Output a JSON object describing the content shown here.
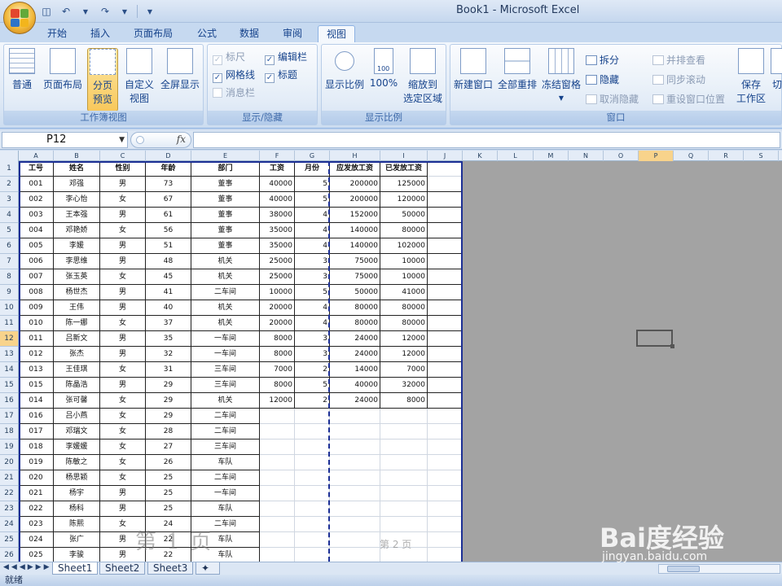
{
  "window": {
    "title": "Book1 - Microsoft Excel"
  },
  "tabs": [
    "开始",
    "插入",
    "页面布局",
    "公式",
    "数据",
    "审阅",
    "视图"
  ],
  "active_tab": "视图",
  "ribbon": {
    "workbook_views": {
      "label": "工作簿视图",
      "normal": "普通",
      "page_layout": "页面布局",
      "page_break_preview_1": "分页",
      "page_break_preview_2": "预览",
      "custom_view_1": "自定义",
      "custom_view_2": "视图",
      "full_screen": "全屏显示"
    },
    "show_hide": {
      "label": "显示/隐藏",
      "ruler": "标尺",
      "gridlines": "网格线",
      "message_bar": "消息栏",
      "formula_bar": "编辑栏",
      "headings": "标题"
    },
    "zoom": {
      "label": "显示比例",
      "zoom": "显示比例",
      "hundred": "100%",
      "zoom_sel_1": "缩放到",
      "zoom_sel_2": "选定区域",
      "icon_100": "100"
    },
    "window": {
      "label": "窗口",
      "new_window": "新建窗口",
      "arrange_all": "全部重排",
      "freeze_panes": "冻结窗格",
      "split": "拆分",
      "hide": "隐藏",
      "unhide": "取消隐藏",
      "side_by_side": "并排查看",
      "sync_scroll": "同步滚动",
      "reset_pos": "重设窗口位置",
      "save_ws_1": "保存",
      "save_ws_2": "工作区",
      "switch": "切"
    }
  },
  "formula_bar": {
    "name_box": "P12",
    "fx": "fx"
  },
  "columns": [
    "A",
    "B",
    "C",
    "D",
    "E",
    "F",
    "G",
    "H",
    "I",
    "J",
    "K",
    "L",
    "M",
    "N",
    "O",
    "P",
    "Q",
    "R",
    "S"
  ],
  "selected_column": "P",
  "selected_row": "12",
  "row_numbers": [
    "1",
    "2",
    "3",
    "4",
    "5",
    "6",
    "7",
    "8",
    "9",
    "10",
    "11",
    "12",
    "13",
    "14",
    "15",
    "16",
    "17",
    "18",
    "19",
    "20",
    "21",
    "22",
    "23",
    "24",
    "25",
    "26"
  ],
  "table": {
    "headers": [
      "工号",
      "姓名",
      "性别",
      "年龄",
      "部门",
      "工资",
      "月份",
      "应发放工资",
      "已发放工资"
    ],
    "rows": [
      [
        "001",
        "邓强",
        "男",
        "73",
        "董事",
        "40000",
        "5",
        "200000",
        "125000"
      ],
      [
        "002",
        "李心怡",
        "女",
        "67",
        "董事",
        "40000",
        "5",
        "200000",
        "120000"
      ],
      [
        "003",
        "王本强",
        "男",
        "61",
        "董事",
        "38000",
        "4",
        "152000",
        "50000"
      ],
      [
        "004",
        "邓艳娇",
        "女",
        "56",
        "董事",
        "35000",
        "4",
        "140000",
        "80000"
      ],
      [
        "005",
        "李媛",
        "男",
        "51",
        "董事",
        "35000",
        "4",
        "140000",
        "102000"
      ],
      [
        "006",
        "李思维",
        "男",
        "48",
        "机关",
        "25000",
        "3",
        "75000",
        "10000"
      ],
      [
        "007",
        "张玉英",
        "女",
        "45",
        "机关",
        "25000",
        "3",
        "75000",
        "10000"
      ],
      [
        "008",
        "杨世杰",
        "男",
        "41",
        "二车间",
        "10000",
        "5",
        "50000",
        "41000"
      ],
      [
        "009",
        "王伟",
        "男",
        "40",
        "机关",
        "20000",
        "4",
        "80000",
        "80000"
      ],
      [
        "010",
        "陈一娜",
        "女",
        "37",
        "机关",
        "20000",
        "4",
        "80000",
        "80000"
      ],
      [
        "011",
        "吕新文",
        "男",
        "35",
        "一车间",
        "8000",
        "3",
        "24000",
        "12000"
      ],
      [
        "012",
        "张杰",
        "男",
        "32",
        "一车间",
        "8000",
        "3",
        "24000",
        "12000"
      ],
      [
        "013",
        "王佳琪",
        "女",
        "31",
        "三车间",
        "7000",
        "2",
        "14000",
        "7000"
      ],
      [
        "015",
        "陈晶浩",
        "男",
        "29",
        "三车间",
        "8000",
        "5",
        "40000",
        "32000"
      ],
      [
        "014",
        "张可馨",
        "女",
        "29",
        "机关",
        "12000",
        "2",
        "24000",
        "8000"
      ],
      [
        "016",
        "吕小燕",
        "女",
        "29",
        "二车间",
        "",
        "",
        "",
        ""
      ],
      [
        "017",
        "邓瑞文",
        "女",
        "28",
        "二车间",
        "",
        "",
        "",
        ""
      ],
      [
        "018",
        "李媛媛",
        "女",
        "27",
        "三车间",
        "",
        "",
        "",
        ""
      ],
      [
        "019",
        "陈敏之",
        "女",
        "26",
        "车队",
        "",
        "",
        "",
        ""
      ],
      [
        "020",
        "杨思颖",
        "女",
        "25",
        "二车间",
        "",
        "",
        "",
        ""
      ],
      [
        "021",
        "杨宇",
        "男",
        "25",
        "一车间",
        "",
        "",
        "",
        ""
      ],
      [
        "022",
        "杨科",
        "男",
        "25",
        "车队",
        "",
        "",
        "",
        ""
      ],
      [
        "023",
        "陈熙",
        "女",
        "24",
        "二车间",
        "",
        "",
        "",
        ""
      ],
      [
        "024",
        "张广",
        "男",
        "22",
        "车队",
        "",
        "",
        "",
        ""
      ],
      [
        "025",
        "李骏",
        "男",
        "22",
        "车队",
        "",
        "",
        "",
        ""
      ]
    ]
  },
  "watermarks": {
    "page1": "第 1 页",
    "page2": "第 2 页"
  },
  "sheets": [
    "Sheet1",
    "Sheet2",
    "Sheet3"
  ],
  "active_sheet": "Sheet1",
  "status": "就绪",
  "baidu": {
    "logo": "Bai度经验",
    "url": "jingyan.baidu.com"
  },
  "colors": {
    "page_break": "#1c2f95",
    "selected_header": "#f8d38b",
    "ribbon_text": "#15428b"
  },
  "icons": [
    "office-button-icon",
    "save-icon",
    "undo-icon",
    "redo-icon",
    "sheet-insert-icon"
  ]
}
